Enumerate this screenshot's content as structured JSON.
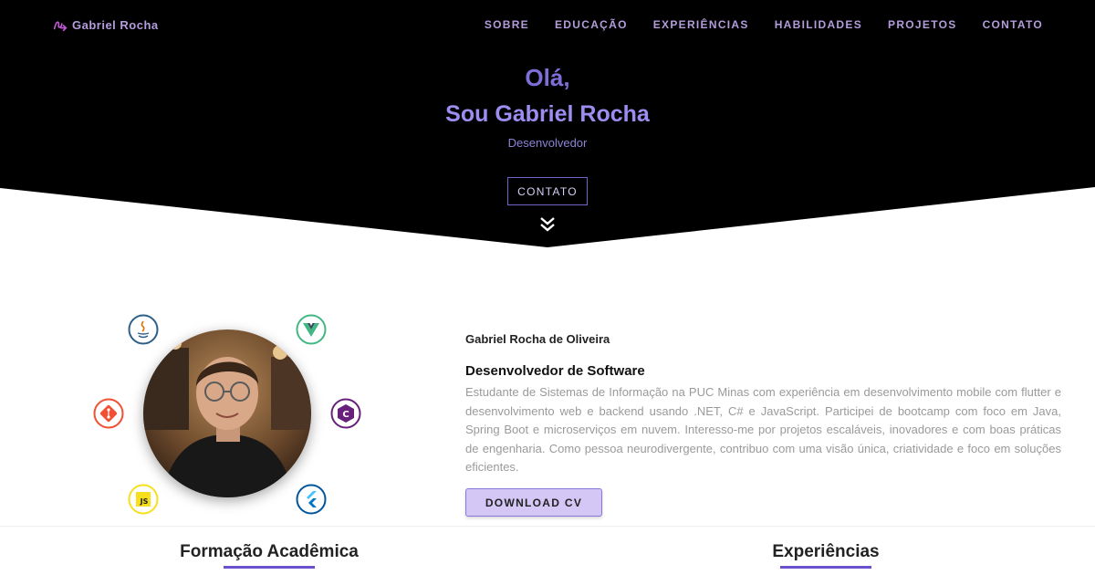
{
  "nav": {
    "brand": "Gabriel Rocha",
    "items": [
      "SOBRE",
      "EDUCAÇÃO",
      "EXPERIÊNCIAS",
      "HABILIDADES",
      "PROJETOS",
      "CONTATO"
    ]
  },
  "hero": {
    "greeting": "Olá,",
    "name": "Sou Gabriel Rocha",
    "role": "Desenvolvedor",
    "contact_button": "CONTATO"
  },
  "about": {
    "full_name": "Gabriel Rocha de Oliveira",
    "headline": "Desenvolvedor de Software",
    "bio": "Estudante de Sistemas de Informação na PUC Minas com experiência em desenvolvimento mobile com flutter e desenvolvimento web e backend usando .NET, C# e JavaScript. Participei de bootcamp com foco em Java, Spring Boot e microserviços em nuvem. Interesso-me por projetos escaláveis, inovadores e com boas práticas de engenharia. Como pessoa neurodivergente, contribuo com uma visão única, criatividade e foco em soluções eficientes.",
    "cv_button": "DOWNLOAD CV",
    "tech_icons": [
      "java-icon",
      "vue-icon",
      "git-icon",
      "csharp-icon",
      "javascript-icon",
      "flutter-icon"
    ]
  },
  "sections": {
    "education_title": "Formação Acadêmica",
    "experience_title": "Experiências"
  },
  "colors": {
    "accent": "#6a4fcf",
    "hero_text": "#9d8df0",
    "hero_bg": "#000000"
  }
}
